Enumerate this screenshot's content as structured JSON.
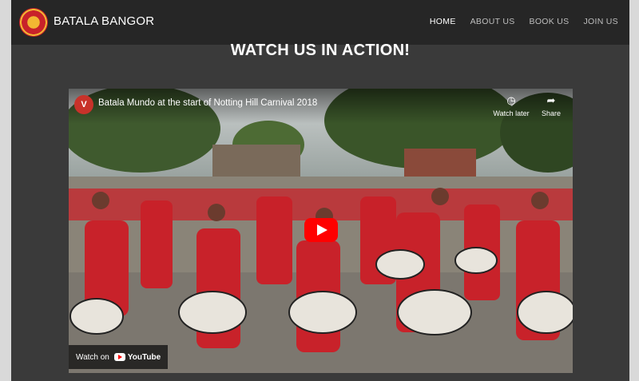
{
  "header": {
    "site_name": "BATALA BANGOR",
    "nav": [
      {
        "label": "HOME",
        "active": true
      },
      {
        "label": "ABOUT US"
      },
      {
        "label": "BOOK US"
      },
      {
        "label": "JOIN US"
      }
    ]
  },
  "main": {
    "heading": "WATCH US IN ACTION!"
  },
  "video": {
    "channel_initial": "V",
    "title": "Batala Mundo at the start of Notting Hill Carnival 2018",
    "watch_later": "Watch later",
    "share": "Share",
    "watch_on": "Watch on",
    "platform": "YouTube",
    "icons": {
      "watch_later": "clock-icon",
      "share": "share-arrow-icon",
      "play": "play-icon"
    }
  },
  "colors": {
    "nav_bg": "#262626",
    "page_bg": "#3a3a3a",
    "drummer_red": "#c8222a",
    "play_red": "#ff0000"
  }
}
